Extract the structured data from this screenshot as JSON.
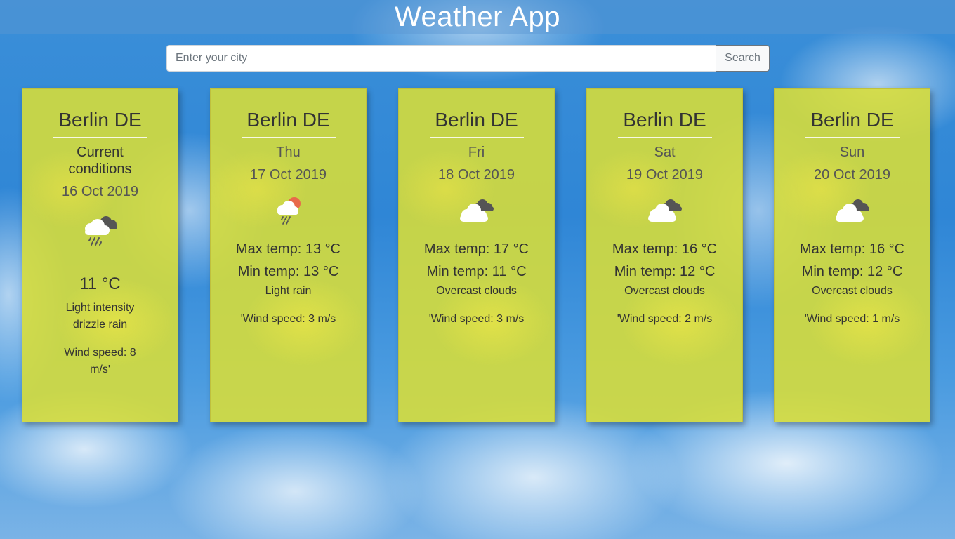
{
  "header": {
    "title": "Weather App"
  },
  "search": {
    "placeholder": "Enter your city",
    "value": "",
    "button_label": "Search"
  },
  "current": {
    "city": "Berlin DE",
    "label": "Current conditions",
    "date": "16 Oct 2019",
    "icon": "rain-cloud-icon",
    "temp": "11 °C",
    "description": "Light intensity drizzle rain",
    "wind": "Wind speed: 8 m/s'"
  },
  "forecast": [
    {
      "city": "Berlin DE",
      "day": "Thu",
      "date": "17 Oct 2019",
      "icon": "sun-rain-cloud-icon",
      "max": "Max temp: 13 °C",
      "min": "Min temp: 13 °C",
      "description": "Light rain",
      "wind": "'Wind speed: 3 m/s"
    },
    {
      "city": "Berlin DE",
      "day": "Fri",
      "date": "18 Oct 2019",
      "icon": "overcast-clouds-icon",
      "max": "Max temp: 17 °C",
      "min": "Min temp: 11 °C",
      "description": "Overcast clouds",
      "wind": "'Wind speed: 3 m/s"
    },
    {
      "city": "Berlin DE",
      "day": "Sat",
      "date": "19 Oct 2019",
      "icon": "overcast-clouds-icon",
      "max": "Max temp: 16 °C",
      "min": "Min temp: 12 °C",
      "description": "Overcast clouds",
      "wind": "'Wind speed: 2 m/s"
    },
    {
      "city": "Berlin DE",
      "day": "Sun",
      "date": "20 Oct 2019",
      "icon": "overcast-clouds-icon",
      "max": "Max temp: 16 °C",
      "min": "Min temp: 12 °C",
      "description": "Overcast clouds",
      "wind": "'Wind speed: 1 m/s"
    }
  ]
}
